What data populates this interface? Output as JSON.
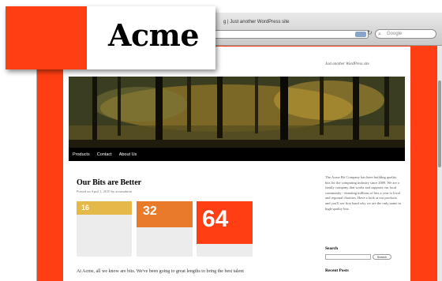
{
  "browser": {
    "tab_title": "g | Just another WordPress site",
    "search_placeholder": "Google",
    "search_icon": "magnifier-icon",
    "reload_icon": "reload-icon"
  },
  "logo": {
    "text": "Acme",
    "accent_color": "#ff3f13"
  },
  "site": {
    "tagline": "Just another WordPress site",
    "nav": [
      "Products",
      "Contact",
      "About Us"
    ]
  },
  "post": {
    "title": "Our Bits are Better",
    "meta": "Posted on April 1, 2010 by acmeadmin",
    "bits": [
      {
        "value": "16",
        "color": "#e5b84a"
      },
      {
        "value": "32",
        "color": "#e87a2a"
      },
      {
        "value": "64",
        "color": "#ff3f13"
      }
    ],
    "body": "At Acme, all we know are bits. We've been going to great lengths to bring the best talent"
  },
  "sidebar": {
    "about": "The Acme Bit Company has been building quality bits for the computing industry since 2009. We are a family company that works and supports our local community - donating millions of bits a year to local and regional charities. Have a look at our products and you'll see first hand why we are the only name in high-quality bits.",
    "search_title": "Search",
    "search_button": "Search",
    "recent_title": "Recent Posts"
  }
}
